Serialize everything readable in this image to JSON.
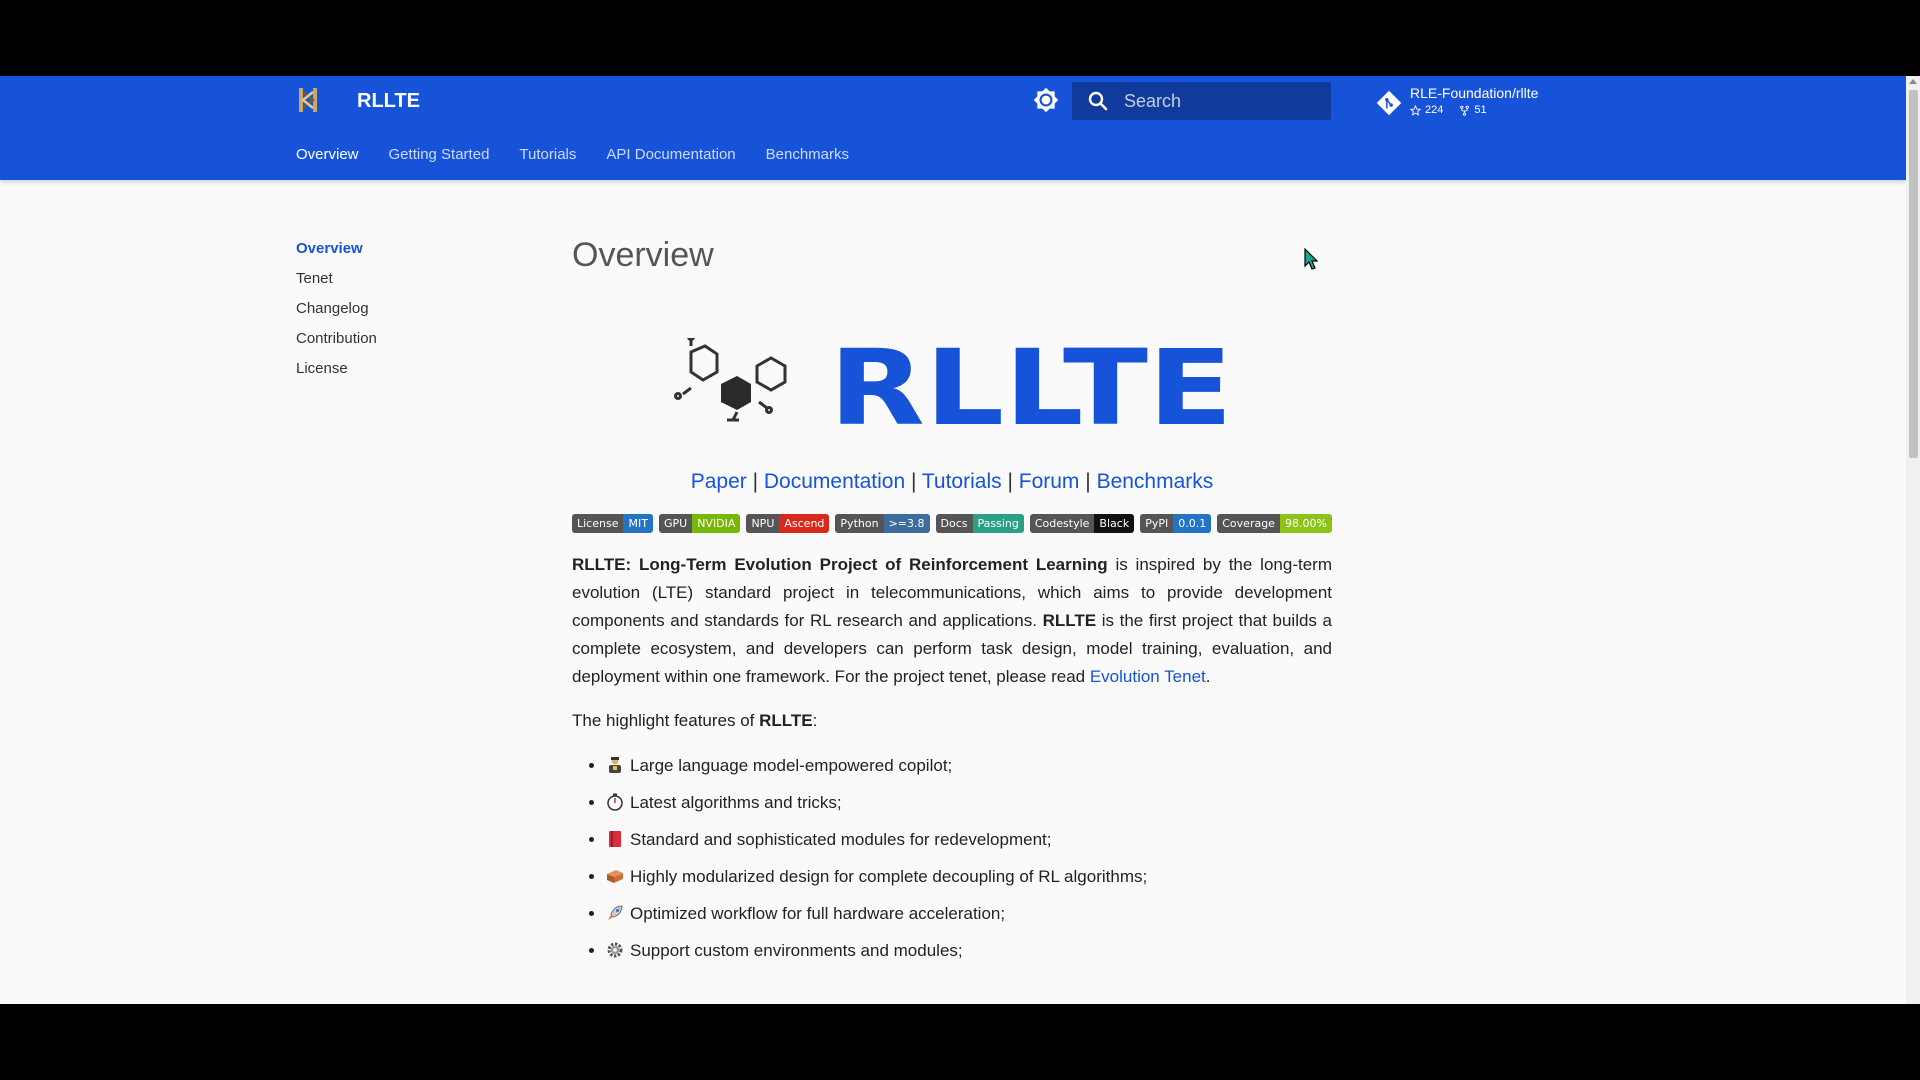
{
  "header": {
    "site_title": "RLLTE",
    "search_placeholder": "Search",
    "repo": {
      "name": "RLE-Foundation/rllte",
      "stars": "224",
      "forks": "51"
    },
    "tabs": [
      "Overview",
      "Getting Started",
      "Tutorials",
      "API Documentation",
      "Benchmarks"
    ]
  },
  "sidebar": {
    "items": [
      "Overview",
      "Tenet",
      "Changelog",
      "Contribution",
      "License"
    ]
  },
  "main": {
    "title": "Overview",
    "banner_text": "RLLTE",
    "links": [
      "Paper",
      "Documentation",
      "Tutorials",
      "Forum",
      "Benchmarks"
    ],
    "badges": [
      {
        "label": "License",
        "value": "MIT",
        "color": "#2474c6"
      },
      {
        "label": "GPU",
        "value": "NVIDIA",
        "color": "#76b900"
      },
      {
        "label": "NPU",
        "value": "Ascend",
        "color": "#d9291c"
      },
      {
        "label": "Python",
        "value": ">=3.8",
        "color": "#3d6d9f"
      },
      {
        "label": "Docs",
        "value": "Passing",
        "color": "#2ba183"
      },
      {
        "label": "Codestyle",
        "value": "Black",
        "color": "#111111"
      },
      {
        "label": "PyPI",
        "value": "0.0.1",
        "color": "#2474c6"
      },
      {
        "label": "Coverage",
        "value": "98.00%",
        "color": "#8bc416"
      }
    ],
    "intro": {
      "bold_title": "RLLTE: Long-Term Evolution Project of Reinforcement Learning",
      "text1": " is inspired by the long-term evolution (LTE) standard project in telecommunications, which aims to provide development components and standards for RL research and applications. ",
      "bold_name": "RLLTE",
      "text2": " is the first project that builds a complete ecosystem, and developers can perform task design, model training, evaluation, and deployment within one framework. For the project tenet, please read ",
      "link": "Evolution Tenet",
      "text3": "."
    },
    "highlights": {
      "prefix": "The highlight features of ",
      "bold": "RLLTE",
      "suffix": ":"
    },
    "features": [
      {
        "icon": "copilot-icon",
        "text": "Large language model-empowered copilot;"
      },
      {
        "icon": "stopwatch-icon",
        "text": "Latest algorithms and tricks;"
      },
      {
        "icon": "book-icon",
        "text": "Standard and sophisticated modules for redevelopment;"
      },
      {
        "icon": "bricks-icon",
        "text": "Highly modularized design for complete decoupling of RL algorithms;"
      },
      {
        "icon": "rocket-icon",
        "text": "Optimized workflow for full hardware acceleration;"
      },
      {
        "icon": "gear-icon",
        "text": "Support custom environments and modules;"
      }
    ]
  },
  "colors": {
    "primary": "#1753d8",
    "background": "#fafafa"
  }
}
